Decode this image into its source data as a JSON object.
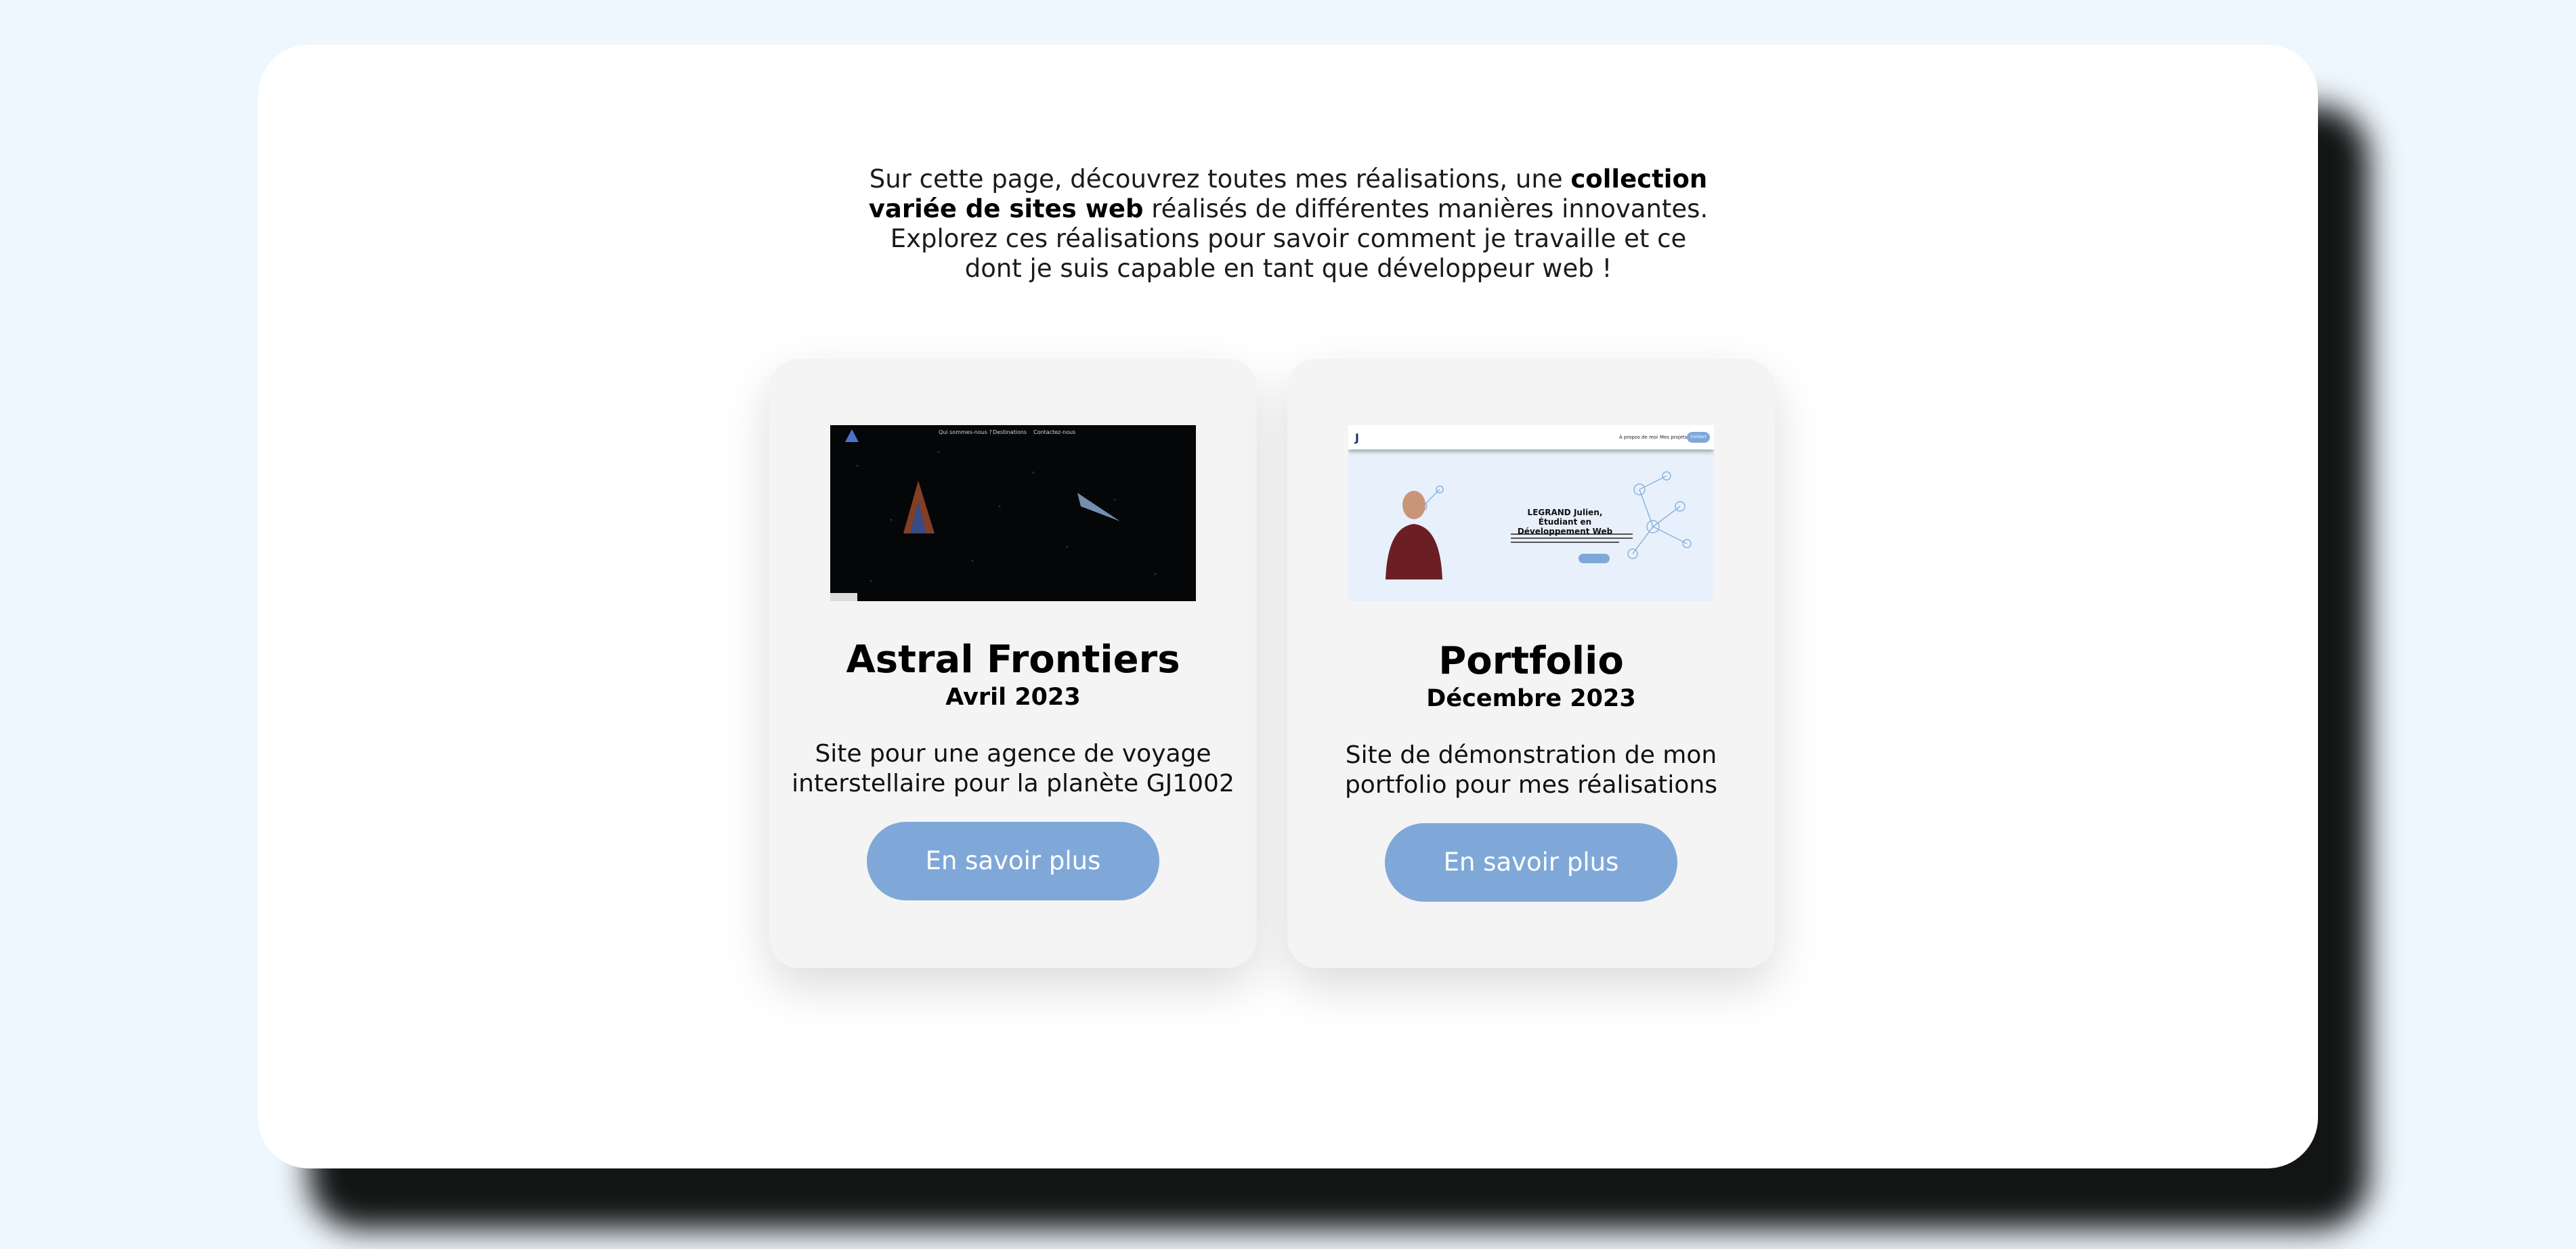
{
  "intro": {
    "part1": "Sur cette page, découvrez toutes mes réalisations, une ",
    "bold": "collection variée de sites web",
    "part2": " réalisés de différentes manières innovantes. Explorez ces réalisations pour savoir comment je travaille et ce dont je suis capable en tant que développeur web !"
  },
  "projects": [
    {
      "title": "Astral Frontiers",
      "date": "Avril 2023",
      "description": "Site pour une agence de voyage interstellaire pour la planète GJ1002",
      "button": "En savoir plus",
      "preview_nav": [
        "Qui sommes-nous ?",
        "Destinations",
        "Contactez-nous"
      ]
    },
    {
      "title": "Portfolio",
      "date": "Décembre 2023",
      "description": "Site de démonstration de mon portfolio pour mes réalisations",
      "button": "En savoir plus",
      "preview_nav": [
        "À propos de moi",
        "Mes projets"
      ],
      "preview_button": "Contact",
      "preview_hero": "LEGRAND Julien, Étudiant en Développement Web"
    }
  ],
  "colors": {
    "page_background": "#eef7fd",
    "panel": "#ffffff",
    "card": "#f4f4f4",
    "button": "#7fa8d8"
  }
}
